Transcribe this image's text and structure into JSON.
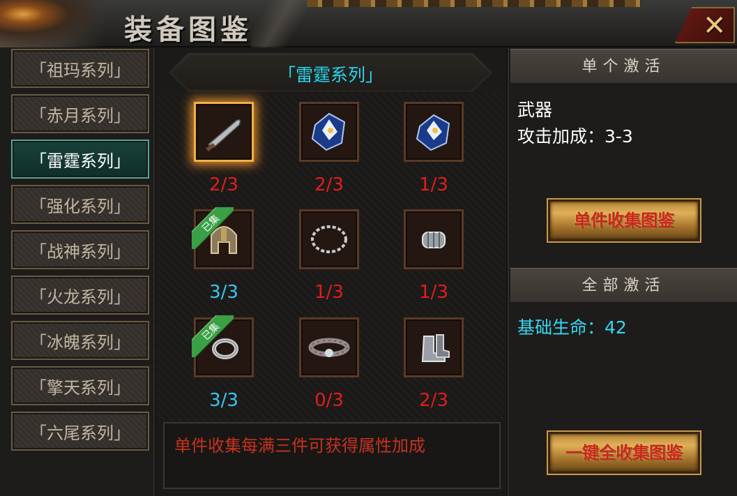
{
  "window": {
    "title": "装备图鉴"
  },
  "tabs": [
    {
      "label": "「祖玛系列」",
      "active": false
    },
    {
      "label": "「赤月系列」",
      "active": false
    },
    {
      "label": "「雷霆系列」",
      "active": true
    },
    {
      "label": "「强化系列」",
      "active": false
    },
    {
      "label": "「战神系列」",
      "active": false
    },
    {
      "label": "「火龙系列」",
      "active": false
    },
    {
      "label": "「冰魄系列」",
      "active": false
    },
    {
      "label": "「擎天系列」",
      "active": false
    },
    {
      "label": "「六尾系列」",
      "active": false
    }
  ],
  "series": {
    "title": "「雷霆系列」"
  },
  "items": [
    {
      "icon": "blade-icon",
      "count": "2/3",
      "collected": false,
      "selected": true
    },
    {
      "icon": "crystal-ore-icon",
      "count": "2/3",
      "collected": false,
      "selected": false
    },
    {
      "icon": "crystal-ore-icon",
      "count": "1/3",
      "collected": false,
      "selected": false
    },
    {
      "icon": "helmet-icon",
      "count": "3/3",
      "collected": true,
      "selected": false
    },
    {
      "icon": "necklace-icon",
      "count": "1/3",
      "collected": false,
      "selected": false
    },
    {
      "icon": "bracer-icon",
      "count": "1/3",
      "collected": false,
      "selected": false
    },
    {
      "icon": "ring-icon",
      "count": "3/3",
      "collected": true,
      "selected": false
    },
    {
      "icon": "belt-icon",
      "count": "0/3",
      "collected": false,
      "selected": false
    },
    {
      "icon": "boots-icon",
      "count": "2/3",
      "collected": false,
      "selected": false
    }
  ],
  "collected_badge": "已集",
  "hint": "单件收集每满三件可获得属性加成",
  "single": {
    "header": "单个激活",
    "item_name": "武器",
    "bonus": "攻击加成：3-3",
    "button": "单件收集图鉴"
  },
  "all": {
    "header": "全部激活",
    "bonus": "基础生命：42",
    "button": "一键全收集图鉴"
  },
  "colors": {
    "count_incomplete": "#e01e1e",
    "count_complete": "#36c6f0",
    "series_title": "#29d6ef",
    "active_tab": "#18413a"
  }
}
